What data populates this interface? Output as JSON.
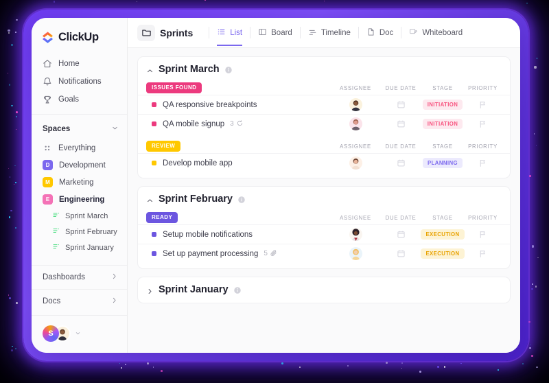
{
  "brand": {
    "name": "ClickUp"
  },
  "sidebar": {
    "nav": [
      {
        "label": "Home",
        "icon": "home-icon"
      },
      {
        "label": "Notifications",
        "icon": "bell-icon"
      },
      {
        "label": "Goals",
        "icon": "trophy-icon"
      }
    ],
    "spaces_title": "Spaces",
    "everything": {
      "label": "Everything",
      "icon": "grid-icon"
    },
    "spaces": [
      {
        "label": "Development",
        "initial": "D",
        "color": "#7b68ee",
        "active": false
      },
      {
        "label": "Marketing",
        "initial": "M",
        "color": "#ffc800",
        "active": false
      },
      {
        "label": "Engineering",
        "initial": "E",
        "color": "#f472b6",
        "active": true
      }
    ],
    "sub_items": [
      {
        "label": "Sprint  March"
      },
      {
        "label": "Sprint  February"
      },
      {
        "label": "Sprint January"
      }
    ],
    "bottom": [
      {
        "label": "Dashboards"
      },
      {
        "label": "Docs"
      }
    ],
    "user": {
      "initial": "S"
    }
  },
  "topbar": {
    "breadcrumb": "Sprints",
    "folder_icon": "folder-icon",
    "tabs": [
      {
        "label": "List",
        "icon": "list-icon",
        "active": true
      },
      {
        "label": "Board",
        "icon": "board-icon",
        "active": false
      },
      {
        "label": "Timeline",
        "icon": "timeline-icon",
        "active": false
      },
      {
        "label": "Doc",
        "icon": "doc-icon",
        "active": false
      },
      {
        "label": "Whiteboard",
        "icon": "whiteboard-icon",
        "active": false
      }
    ]
  },
  "columns": {
    "assignee": "ASSIGNEE",
    "due_date": "DUE DATE",
    "stage": "STAGE",
    "priority": "PRIORITY"
  },
  "groups": [
    {
      "title": "Sprint March",
      "collapsed": false,
      "sections": [
        {
          "tag": "ISSUES FOUND",
          "tag_bg": "#ec3a7e",
          "tasks": [
            {
              "name": "QA responsive breakpoints",
              "dot": "#ec3a7e",
              "meta_count": "",
              "meta_icon": "",
              "avatar": "beard-man",
              "due": "",
              "stage": "INITIATION",
              "stage_color": "#f8537f",
              "stage_bg": "#fde9ef"
            },
            {
              "name": "QA mobile signup",
              "dot": "#ec3a7e",
              "meta_count": "3",
              "meta_icon": "recurring-icon",
              "avatar": "pink-man",
              "due": "",
              "stage": "INITIATION",
              "stage_color": "#f8537f",
              "stage_bg": "#fde9ef"
            }
          ]
        },
        {
          "tag": "REVIEW",
          "tag_bg": "#ffc800",
          "tasks": [
            {
              "name": "Develop mobile app",
              "dot": "#ffc800",
              "meta_count": "",
              "meta_icon": "",
              "avatar": "woman-a",
              "due": "",
              "stage": "PLANNING",
              "stage_color": "#7b68ee",
              "stage_bg": "#eceafd"
            }
          ]
        }
      ]
    },
    {
      "title": "Sprint February",
      "collapsed": false,
      "sections": [
        {
          "tag": "READY",
          "tag_bg": "#6c56e0",
          "tasks": [
            {
              "name": "Setup mobile notifications",
              "dot": "#6c56e0",
              "meta_count": "",
              "meta_icon": "",
              "avatar": "afro-woman",
              "due": "",
              "stage": "EXECUTION",
              "stage_color": "#e8a200",
              "stage_bg": "#fdf3d4"
            },
            {
              "name": "Set up payment processing",
              "dot": "#6c56e0",
              "meta_count": "5",
              "meta_icon": "attachment-icon",
              "avatar": "blonde-woman",
              "due": "",
              "stage": "EXECUTION",
              "stage_color": "#e8a200",
              "stage_bg": "#fdf3d4"
            }
          ]
        }
      ]
    },
    {
      "title": "Sprint January",
      "collapsed": true,
      "sections": []
    }
  ]
}
